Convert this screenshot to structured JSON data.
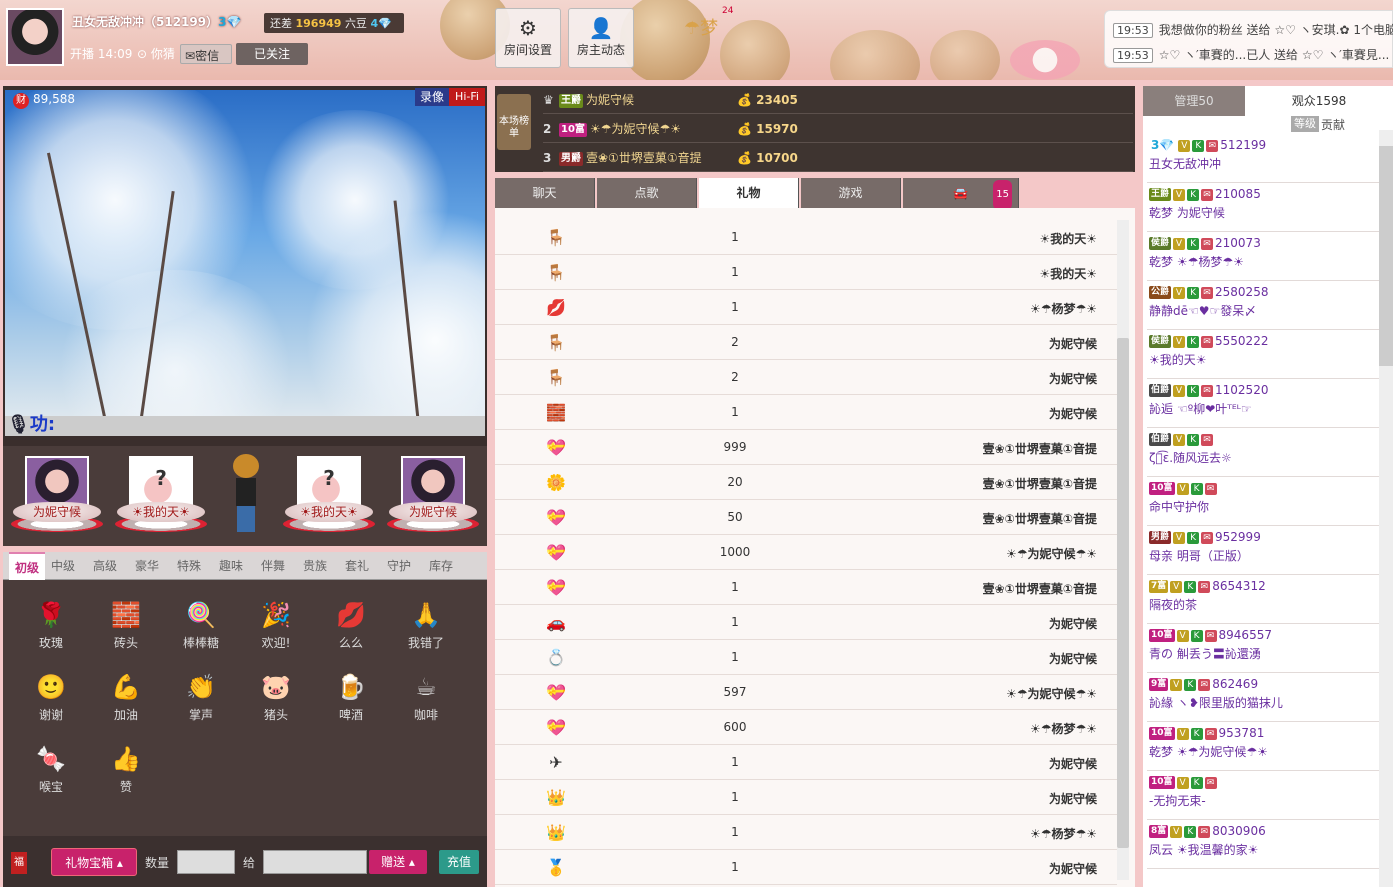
{
  "host": {
    "name": "丑女无敌冲冲（512199）",
    "diamond": "3💎",
    "level_gap_prefix": "还差",
    "level_gap_value": "196949",
    "level_gap_unit": "六豆",
    "next_level": "4💎",
    "live_time": "开播 14:09",
    "location": "你猜",
    "message_label": "密信",
    "follow_label": "已关注"
  },
  "toolbar": {
    "room_settings": "房间设置",
    "host_feed": "房主动态",
    "gift_count": "24",
    "gift_text": "梦"
  },
  "notifications": [
    {
      "time": "19:53",
      "text": "我想做你的粉丝 送给 ☆♡ ヽ安琪.✿ 1个电脑"
    },
    {
      "time": "19:53",
      "text": "☆♡ ヽ′車賽的...已人 送给 ☆♡ ヽ′車賽見..."
    }
  ],
  "video": {
    "wealth": "89,588",
    "wealth_icon": "财",
    "record_label": "录像",
    "hifi_label": "Hi-Fi",
    "mic_text": "功:"
  },
  "seats": [
    {
      "name": "为妮守候"
    },
    {
      "name": "☀我的天☀"
    },
    {
      "name": ""
    },
    {
      "name": "☀我的天☀"
    },
    {
      "name": "为妮守候"
    }
  ],
  "gift_tabs": [
    "初级",
    "中级",
    "高级",
    "豪华",
    "特殊",
    "趣味",
    "伴舞",
    "贵族",
    "套礼",
    "守护",
    "库存"
  ],
  "gifts": [
    {
      "label": "玫瑰",
      "icon": "🌹"
    },
    {
      "label": "砖头",
      "icon": "🧱"
    },
    {
      "label": "棒棒糖",
      "icon": "🍭"
    },
    {
      "label": "欢迎!",
      "icon": "🎉"
    },
    {
      "label": "么么",
      "icon": "💋"
    },
    {
      "label": "我错了",
      "icon": "🙏"
    },
    {
      "label": "谢谢",
      "icon": "🙂"
    },
    {
      "label": "加油",
      "icon": "💪"
    },
    {
      "label": "掌声",
      "icon": "👏"
    },
    {
      "label": "猪头",
      "icon": "🐷"
    },
    {
      "label": "啤酒",
      "icon": "🍺"
    },
    {
      "label": "咖啡",
      "icon": "☕"
    },
    {
      "label": "喉宝",
      "icon": "🍬"
    },
    {
      "label": "赞",
      "icon": "👍"
    }
  ],
  "bottom": {
    "gift_box": "礼物宝箱",
    "qty_label": "数量",
    "to_label": "给",
    "send_label": "赠送",
    "recharge_label": "充值"
  },
  "ranking": {
    "label": "本场榜单",
    "rows": [
      {
        "no": "",
        "lvl": "王爵",
        "name": "为妮守候",
        "coins": "23405"
      },
      {
        "no": "2",
        "lvl": "10富",
        "name": "☀☂为妮守候☂☀",
        "coins": "15970"
      },
      {
        "no": "3",
        "lvl": "男爵",
        "name": "壹❀①丗堺壹菓①音提",
        "coins": "10700"
      }
    ]
  },
  "main_tabs": [
    "聊天",
    "点歌",
    "礼物",
    "游戏"
  ],
  "car_count": "15",
  "gift_log": [
    {
      "icon": "🪑",
      "count": "1",
      "from": "☀我的天☀"
    },
    {
      "icon": "🪑",
      "count": "1",
      "from": "☀我的天☀"
    },
    {
      "icon": "💋",
      "count": "1",
      "from": "☀☂杨梦☂☀"
    },
    {
      "icon": "🪑",
      "count": "2",
      "from": "为妮守候"
    },
    {
      "icon": "🪑",
      "count": "2",
      "from": "为妮守候"
    },
    {
      "icon": "🧱",
      "count": "1",
      "from": "为妮守候"
    },
    {
      "icon": "💝",
      "count": "999",
      "from": "壹❀①丗堺壹菓①音提"
    },
    {
      "icon": "🌼",
      "count": "20",
      "from": "壹❀①丗堺壹菓①音提"
    },
    {
      "icon": "💝",
      "count": "50",
      "from": "壹❀①丗堺壹菓①音提"
    },
    {
      "icon": "💝",
      "count": "1000",
      "from": "☀☂为妮守候☂☀"
    },
    {
      "icon": "💝",
      "count": "1",
      "from": "壹❀①丗堺壹菓①音提"
    },
    {
      "icon": "🚗",
      "count": "1",
      "from": "为妮守候"
    },
    {
      "icon": "💍",
      "count": "1",
      "from": "为妮守候"
    },
    {
      "icon": "💝",
      "count": "597",
      "from": "☀☂为妮守候☂☀"
    },
    {
      "icon": "💝",
      "count": "600",
      "from": "☀☂杨梦☂☀"
    },
    {
      "icon": "✈",
      "count": "1",
      "from": "为妮守候"
    },
    {
      "icon": "👑",
      "count": "1",
      "from": "为妮守候"
    },
    {
      "icon": "👑",
      "count": "1",
      "from": "☀☂杨梦☂☀"
    },
    {
      "icon": "🥇",
      "count": "1",
      "from": "为妮守候"
    }
  ],
  "audience": {
    "admin_tab": "管理50",
    "viewers_tab": "观众1598",
    "sort_level": "等级",
    "sort_contrib": "贡献",
    "rows": [
      {
        "badges": "3💎",
        "id": "512199",
        "name": "丑女无敌冲冲",
        "lvl": ""
      },
      {
        "badges": "王爵",
        "id": "210085",
        "name": "乾梦 为妮守候",
        "lvl": "王爵"
      },
      {
        "badges": "侯爵",
        "id": "210073",
        "name": "乾梦 ☀☂杨梦☂☀",
        "lvl": "侯爵"
      },
      {
        "badges": "公爵",
        "id": "2580258",
        "name": "静静dē☜♥☞發呆〆",
        "lvl": "公爵"
      },
      {
        "badges": "侯爵",
        "id": "5550222",
        "name": "☀我的天☀",
        "lvl": "侯爵"
      },
      {
        "badges": "伯爵",
        "id": "1102520",
        "name": "訫逅 ☜º柳❤叶ᵀᴱᴸ☞",
        "lvl": "伯爵"
      },
      {
        "badges": "伯爵",
        "id": "",
        "name": "ζั͡ε.随风远去☼",
        "lvl": "伯爵"
      },
      {
        "badges": "10富",
        "id": "",
        "name": "命中守护你",
        "lvl": "10富"
      },
      {
        "badges": "男爵",
        "id": "952999",
        "name": "母亲 明哥（正版）",
        "lvl": "男爵"
      },
      {
        "badges": "7富",
        "id": "8654312",
        "name": "隔夜的茶",
        "lvl": "7富"
      },
      {
        "badges": "10富",
        "id": "8946557",
        "name": "青の 觓丢う〓訫還湧",
        "lvl": "10富"
      },
      {
        "badges": "9富",
        "id": "862469",
        "name": "訫緣 ヽ❥限里版的猫抹儿",
        "lvl": "9富"
      },
      {
        "badges": "10富",
        "id": "953781",
        "name": "乾梦 ☀☂为妮守候☂☀",
        "lvl": "10富"
      },
      {
        "badges": "10富",
        "id": "",
        "name": "-无拘无束-",
        "lvl": "10富"
      },
      {
        "badges": "8富",
        "id": "8030906",
        "name": "凤云 ☀我温馨的家☀",
        "lvl": "8富"
      }
    ]
  },
  "colors": {
    "accent": "#c8226b",
    "panel_dark": "#3e3430",
    "header_bg": "#eab9ae"
  }
}
